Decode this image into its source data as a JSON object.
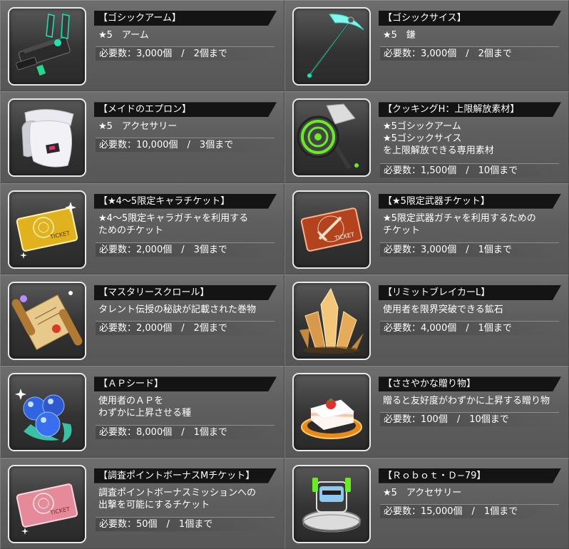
{
  "items": [
    {
      "title": "【ゴシックアーム】",
      "desc": [
        "★5　アーム"
      ],
      "required": "必要数：3,000個　/　2個まで",
      "icon": "gothic-arm-icon"
    },
    {
      "title": "【ゴシックサイス】",
      "desc": [
        "★5　鎌"
      ],
      "required": "必要数：3,000個　/　2個まで",
      "icon": "gothic-scythe-icon"
    },
    {
      "title": "【メイドのエプロン】",
      "desc": [
        "★5　アクセサリー"
      ],
      "required": "必要数：10,000個　/　3個まで",
      "icon": "maid-apron-icon"
    },
    {
      "title": "【クッキングH：上限解放素材】",
      "desc": [
        "★5ゴシックアーム",
        "★5ゴシックサイス",
        "を上限解放できる専用素材"
      ],
      "required": "必要数：1,500個　/　10個まで",
      "icon": "cooking-hammer-icon"
    },
    {
      "title": "【★4～5限定キャラチケット】",
      "desc": [
        "★4～5限定キャラガチャを利用する",
        "ためのチケット"
      ],
      "required": "必要数：2,000個　/　3個まで",
      "icon": "gold-ticket-icon"
    },
    {
      "title": "【★5限定武器チケット】",
      "desc": [
        "★5限定武器ガチャを利用するための",
        "チケット"
      ],
      "required": "必要数：3,000個　/　1個まで",
      "icon": "weapon-ticket-icon"
    },
    {
      "title": "【マスタリースクロール】",
      "desc": [
        "タレント伝授の秘訣が記載された巻物"
      ],
      "required": "必要数：2,000個　/　2個まで",
      "icon": "scroll-icon"
    },
    {
      "title": "【リミットブレイカーL】",
      "desc": [
        "使用者を限界突破できる鉱石"
      ],
      "required": "必要数：4,000個　/　1個まで",
      "icon": "crystal-ore-icon"
    },
    {
      "title": "【ＡＰシード】",
      "desc": [
        "使用者のＡＰを",
        "わずかに上昇させる種"
      ],
      "required": "必要数：8,000個　/　1個まで",
      "icon": "berry-seed-icon"
    },
    {
      "title": "【ささやかな贈り物】",
      "desc": [
        "贈ると友好度がわずかに上昇する贈り物"
      ],
      "required": "必要数：100個　/　10個まで",
      "icon": "cake-icon"
    },
    {
      "title": "【調査ポイントボーナスMチケット】",
      "desc": [
        "調査ポイントボーナスミッションへの",
        "出撃を可能にするチケット"
      ],
      "required": "必要数：50個　/　1個まで",
      "icon": "pink-ticket-icon"
    },
    {
      "title": "【Ｒｏｂｏｔ・Ｄ−79】",
      "desc": [
        "★5　アクセサリー"
      ],
      "required": "必要数：15,000個　/　1個まで",
      "icon": "robot-vacuum-icon"
    }
  ]
}
